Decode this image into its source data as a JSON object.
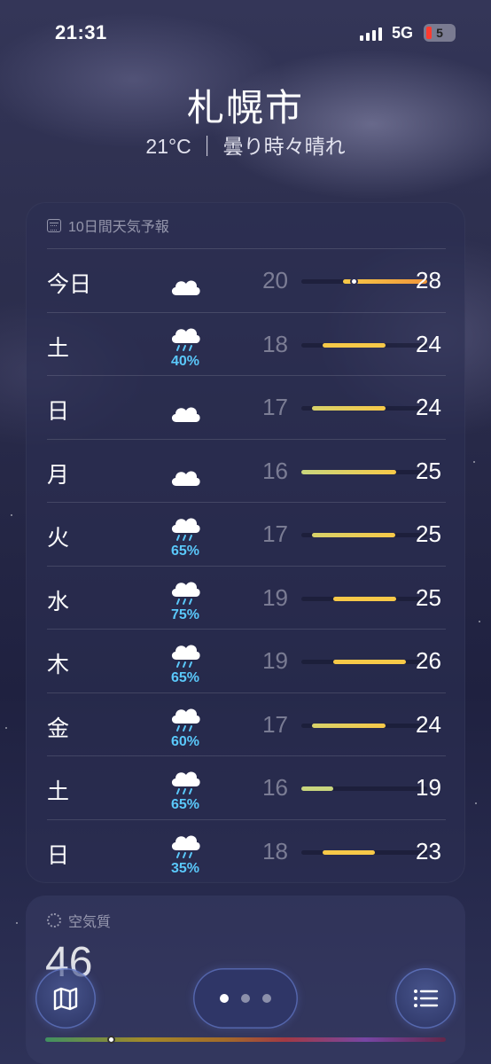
{
  "status_bar": {
    "time": "21:31",
    "network": "5G",
    "battery_level": "5",
    "battery_color": "#ff3b30"
  },
  "location": {
    "city": "札幌市",
    "summary": "21°C ｜ 曇り時々晴れ"
  },
  "forecast": {
    "title": "10日間天気予報",
    "icon": "calendar-icon",
    "scale_min": 16,
    "scale_max": 28,
    "current_temp": 21,
    "days": [
      {
        "day": "今日",
        "icon": "cloud-icon",
        "precip": "",
        "low": "20",
        "high": "28"
      },
      {
        "day": "土",
        "icon": "cloud-rain-icon",
        "precip": "40%",
        "low": "18",
        "high": "24"
      },
      {
        "day": "日",
        "icon": "cloud-icon",
        "precip": "",
        "low": "17",
        "high": "24"
      },
      {
        "day": "月",
        "icon": "cloud-icon",
        "precip": "",
        "low": "16",
        "high": "25"
      },
      {
        "day": "火",
        "icon": "cloud-rain-icon",
        "precip": "65%",
        "low": "17",
        "high": "25"
      },
      {
        "day": "水",
        "icon": "cloud-rain-icon",
        "precip": "75%",
        "low": "19",
        "high": "25"
      },
      {
        "day": "木",
        "icon": "cloud-rain-icon",
        "precip": "65%",
        "low": "19",
        "high": "26"
      },
      {
        "day": "金",
        "icon": "cloud-rain-icon",
        "precip": "60%",
        "low": "17",
        "high": "24"
      },
      {
        "day": "土",
        "icon": "cloud-rain-icon",
        "precip": "65%",
        "low": "16",
        "high": "19"
      },
      {
        "day": "日",
        "icon": "cloud-rain-icon",
        "precip": "35%",
        "low": "18",
        "high": "23"
      }
    ]
  },
  "air_quality": {
    "title": "空気質",
    "value": "46",
    "icon": "air-quality-icon"
  },
  "bottom_bar": {
    "map_icon": "map-icon",
    "list_icon": "list-icon",
    "pages": 3,
    "active_page": 0
  },
  "colors": {
    "precip": "#5ac8fa",
    "bar_cool": "#c9d67e",
    "bar_warm": "#f7c948",
    "bar_hot": "#f0963a"
  }
}
